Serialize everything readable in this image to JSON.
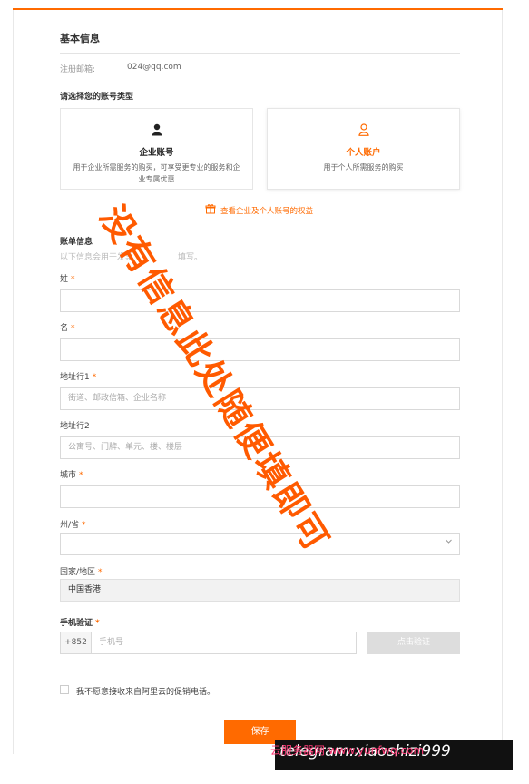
{
  "section_basic": {
    "title": "基本信息"
  },
  "email": {
    "label": "注册邮箱:",
    "value": "024@qq.com"
  },
  "account_type": {
    "prompt": "请选择您的账号类型",
    "enterprise": {
      "title": "企业账号",
      "desc": "用于企业所需服务的购买，可享受更专业的服务和企业专属优惠",
      "icon": "user-solid-icon"
    },
    "personal": {
      "title": "个人账户",
      "desc": "用于个人所需服务的购买",
      "icon": "user-outline-icon"
    }
  },
  "benefits_link": {
    "text": "查看企业及个人账号的权益",
    "icon": "gift-icon"
  },
  "billing": {
    "title": "账单信息",
    "subtitle": "以下信息会用于发票",
    "subtitle_tail": "填写。"
  },
  "fields": {
    "last_name": {
      "label": "姓",
      "required": "*",
      "placeholder": ""
    },
    "first_name": {
      "label": "名",
      "required": "*",
      "placeholder": ""
    },
    "address1": {
      "label": "地址行1",
      "required": "*",
      "placeholder": "街道、邮政信箱、企业名称"
    },
    "address2": {
      "label": "地址行2",
      "placeholder": "公寓号、门牌、单元、楼、楼层"
    },
    "city": {
      "label": "城市",
      "required": "*",
      "placeholder": ""
    },
    "state": {
      "label": "州/省",
      "required": "*",
      "value": ""
    },
    "country": {
      "label": "国家/地区",
      "required": "*",
      "value": "中国香港"
    },
    "phone": {
      "label": "手机验证",
      "required": "*",
      "prefix": "+852",
      "placeholder": "手机号",
      "verify_button": "点击验证"
    }
  },
  "optout": {
    "text": "我不愿意接收来自阿里云的促销电话。"
  },
  "save_button": "保存",
  "watermark": "没有信息此处随便填即可",
  "footer": {
    "text": "telegram:xiaoshizi999",
    "overlay": "云服务器网 www.yunfwq.com"
  },
  "colors": {
    "accent": "#ff6a00",
    "watermark": "#ff5a00"
  }
}
